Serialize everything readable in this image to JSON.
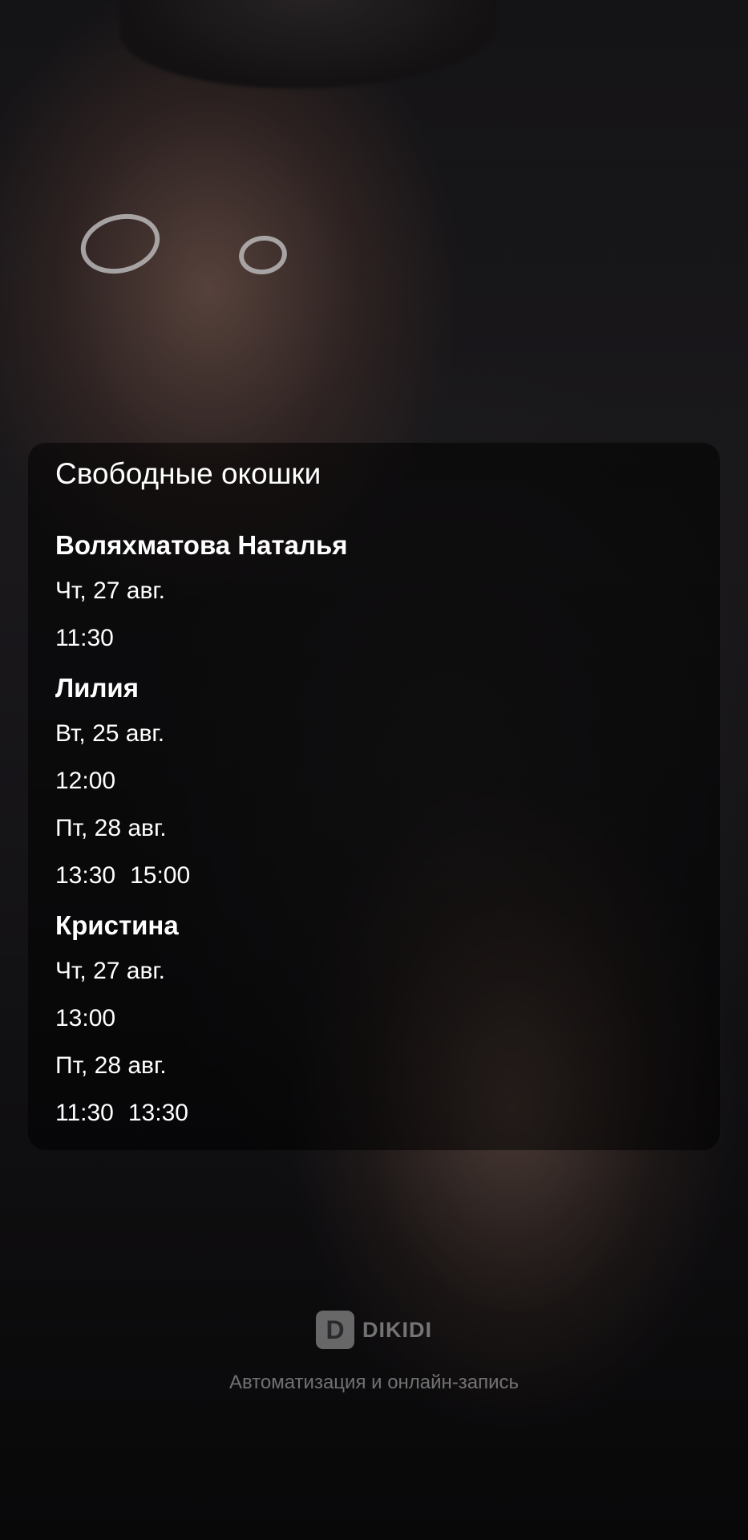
{
  "card": {
    "title": "Свободные окошки",
    "masters": [
      {
        "name": "Воляхматова Наталья",
        "days": [
          {
            "date": "Чт, 27 авг.",
            "times": [
              "11:30"
            ]
          }
        ]
      },
      {
        "name": "Лилия",
        "days": [
          {
            "date": "Вт, 25 авг.",
            "times": [
              "12:00"
            ]
          },
          {
            "date": "Пт, 28 авг.",
            "times": [
              "13:30",
              "15:00"
            ]
          }
        ]
      },
      {
        "name": "Кристина",
        "days": [
          {
            "date": "Чт, 27 авг.",
            "times": [
              "13:00"
            ]
          },
          {
            "date": "Пт, 28 авг.",
            "times": [
              "11:30",
              "13:30"
            ]
          }
        ]
      }
    ]
  },
  "footer": {
    "logo_letter": "D",
    "brand": "DIKIDI",
    "tagline": "Автоматизация и онлайн-запись"
  }
}
